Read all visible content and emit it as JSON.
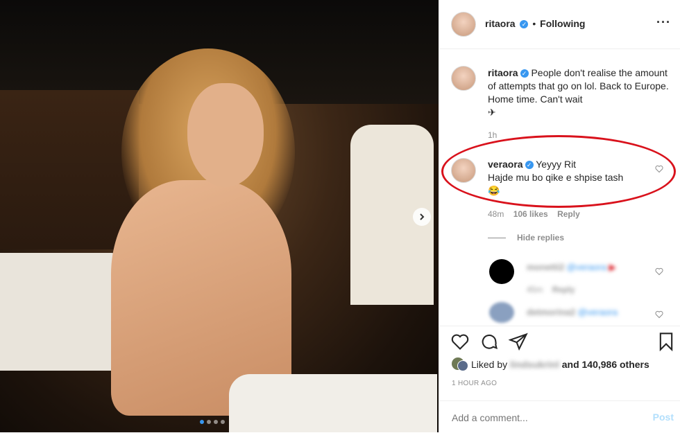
{
  "post": {
    "username": "ritaora",
    "follow_status": "Following",
    "separator": "•",
    "more_icon": "more-horizontal-icon"
  },
  "caption": {
    "username": "ritaora",
    "text": "People don't realise the amount of attempts that go on lol. Back to Europe. Home time. Can't wait",
    "emoji": "✈",
    "time": "1h"
  },
  "comment": {
    "username": "veraora",
    "line1": "Yeyyy Rit",
    "line2": "Hajde mu bo qike e shpise tash",
    "emoji": "😂",
    "time": "48m",
    "likes": "106 likes",
    "reply": "Reply",
    "hide_replies": "Hide replies"
  },
  "replies": [
    {
      "username": "monetti2",
      "mention": "@veraora",
      "time": "45m",
      "reply": "Reply"
    },
    {
      "username": "detmorina2",
      "mention": "@veraora"
    }
  ],
  "likes": {
    "prefix": "Liked by",
    "user": "lindsukrinl",
    "suffix": "and 140,986 others"
  },
  "timestamp": "1 HOUR AGO",
  "add_comment": {
    "placeholder": "Add a comment...",
    "post_label": "Post"
  },
  "colors": {
    "verified": "#3897f0",
    "annotation_circle": "#d9121c",
    "post_disabled": "#b2dffc"
  }
}
